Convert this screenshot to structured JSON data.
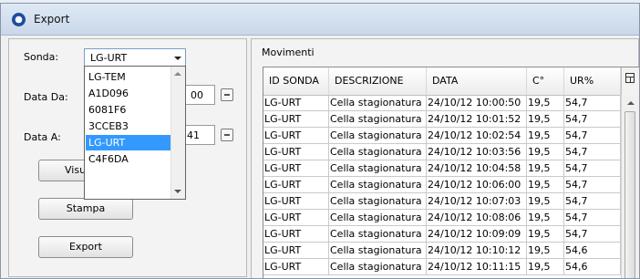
{
  "window": {
    "title": "Export"
  },
  "filters": {
    "sonda_label": "Sonda:",
    "sonda_value": "LG-URT",
    "sonda_options": [
      "LG-TEM",
      "A1D096",
      "6081F6",
      "3CCEB3",
      "LG-URT",
      "C4F6DA"
    ],
    "sonda_selected_index": 4,
    "data_da_label": "Data Da:",
    "data_da_time_partial": "00",
    "data_a_label": "Data A:",
    "data_a_time_partial": "41"
  },
  "buttons": {
    "visualizza_partial": "Visu",
    "stampa": "Stampa",
    "export": "Export"
  },
  "movimenti": {
    "title": "Movimenti",
    "columns": [
      "ID SONDA",
      "DESCRIZIONE",
      "DATA",
      "C°",
      "UR%"
    ],
    "rows": [
      [
        "LG-URT",
        "Cella stagionatura",
        "24/10/12 10:00:50",
        "19,5",
        "54,7"
      ],
      [
        "LG-URT",
        "Cella stagionatura",
        "24/10/12 10:01:52",
        "19,5",
        "54,7"
      ],
      [
        "LG-URT",
        "Cella stagionatura",
        "24/10/12 10:02:54",
        "19,5",
        "54,7"
      ],
      [
        "LG-URT",
        "Cella stagionatura",
        "24/10/12 10:03:56",
        "19,5",
        "54,7"
      ],
      [
        "LG-URT",
        "Cella stagionatura",
        "24/10/12 10:04:58",
        "19,5",
        "54,7"
      ],
      [
        "LG-URT",
        "Cella stagionatura",
        "24/10/12 10:06:00",
        "19,5",
        "54,7"
      ],
      [
        "LG-URT",
        "Cella stagionatura",
        "24/10/12 10:07:03",
        "19,5",
        "54,7"
      ],
      [
        "LG-URT",
        "Cella stagionatura",
        "24/10/12 10:08:06",
        "19,5",
        "54,7"
      ],
      [
        "LG-URT",
        "Cella stagionatura",
        "24/10/12 10:09:09",
        "19,5",
        "54,7"
      ],
      [
        "LG-URT",
        "Cella stagionatura",
        "24/10/12 10:10:12",
        "19,5",
        "54,6"
      ],
      [
        "LG-URT",
        "Cella stagionatura",
        "24/10/12 10:11:15",
        "19,5",
        "54,6"
      ]
    ]
  },
  "icons": {
    "app": "app-power-icon",
    "calendar": "calendar-icon",
    "column_chooser": "column-chooser-icon"
  }
}
